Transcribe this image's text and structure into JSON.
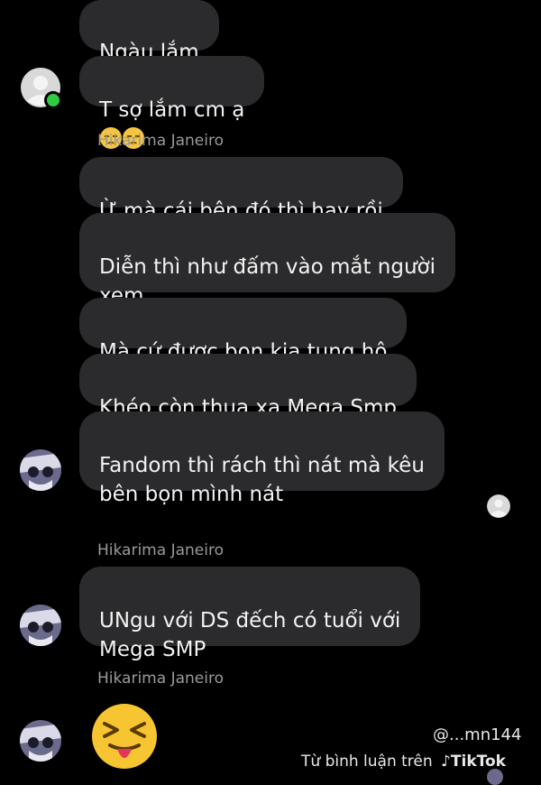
{
  "messages": [
    {
      "text": "Ngàu lắm"
    },
    {
      "text": "T sợ lắm cm ạ"
    },
    {
      "text": "Ừ mà cái bên đó thì hay rồi"
    },
    {
      "text": "Diễn thì như đấm vào mắt người\nxem"
    },
    {
      "text": "Mà cứ được bọn kia tung hô"
    },
    {
      "text": "Khéo còn thua xa Mega Smp"
    },
    {
      "text": "Fandom thì rách thì nát mà kêu\nbên bọn mình nát"
    },
    {
      "text": "UNgu với DS đếch có tuổi với\nMega SMP"
    }
  ],
  "senders": {
    "s1": "Hikarima Janeiro",
    "s2": "Hikarima Janeiro",
    "s3": "Hikarima Janeiro"
  },
  "watermark": {
    "handle": "@...mn144",
    "source": "Từ bình luận trên",
    "brand": "TikTok"
  },
  "icons": {
    "sad": "pensive-face-icon",
    "love": "smiling-face-with-hearts-icon",
    "big": "squinting-tongue-face-icon"
  },
  "colors": {
    "background": "#000000",
    "bubble": "#2b2b2d",
    "online": "#2ecc40"
  }
}
